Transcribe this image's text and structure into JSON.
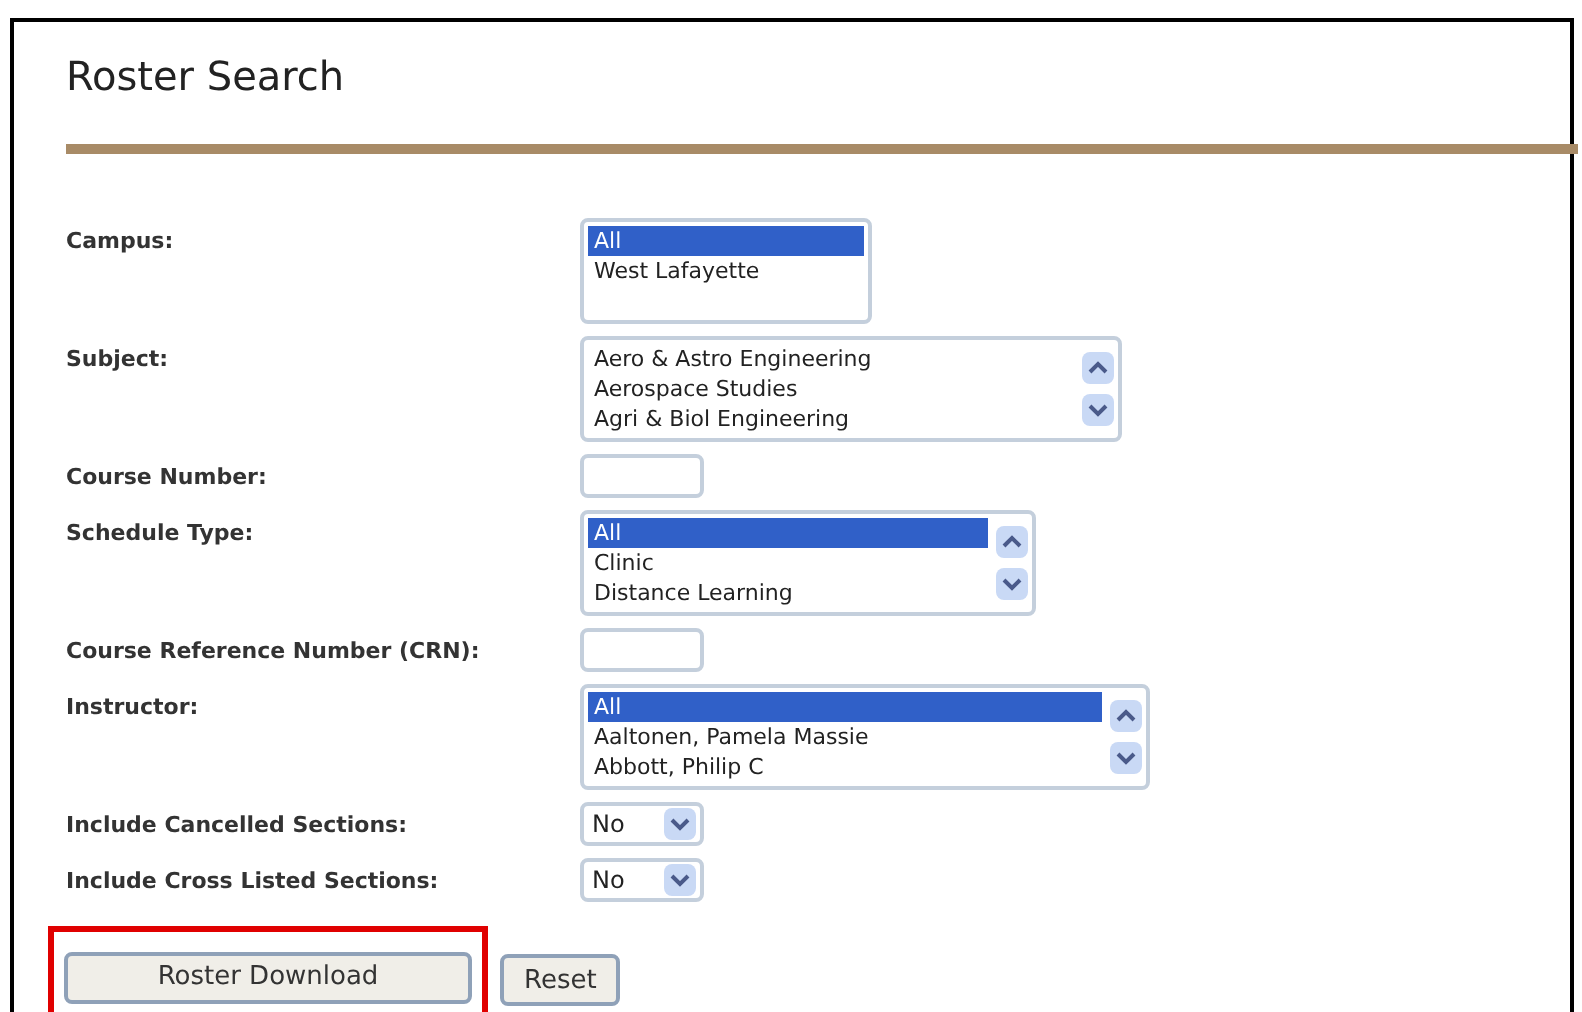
{
  "page": {
    "title": "Roster Search"
  },
  "fields": [
    {
      "label": "Campus:",
      "kind": "list",
      "options": [
        {
          "text": "All",
          "selected": true
        },
        {
          "text": "West Lafayette",
          "selected": false
        }
      ]
    },
    {
      "label": "Subject:",
      "kind": "scroll_list",
      "options": [
        {
          "text": "Aero & Astro Engineering",
          "selected": false
        },
        {
          "text": "Aerospace Studies",
          "selected": false
        },
        {
          "text": "Agri & Biol Engineering",
          "selected": false
        }
      ]
    },
    {
      "label": "Course Number:",
      "kind": "text"
    },
    {
      "label": "Schedule Type:",
      "kind": "scroll_list",
      "options": [
        {
          "text": "All",
          "selected": true
        },
        {
          "text": "Clinic",
          "selected": false
        },
        {
          "text": "Distance Learning",
          "selected": false
        }
      ]
    },
    {
      "label": "Course Reference Number (CRN):",
      "kind": "text"
    },
    {
      "label": "Instructor:",
      "kind": "scroll_list",
      "options": [
        {
          "text": "All",
          "selected": true
        },
        {
          "text": "Aaltonen, Pamela Massie",
          "selected": false
        },
        {
          "text": "Abbott, Philip C",
          "selected": false
        }
      ]
    },
    {
      "label": "Include Cancelled Sections:",
      "kind": "select",
      "value": "No"
    },
    {
      "label": "Include Cross Listed Sections:",
      "kind": "select",
      "value": "No"
    }
  ],
  "buttons": [
    {
      "label": "Roster Download",
      "highlighted": true
    },
    {
      "label": "Reset",
      "highlighted": false
    }
  ]
}
